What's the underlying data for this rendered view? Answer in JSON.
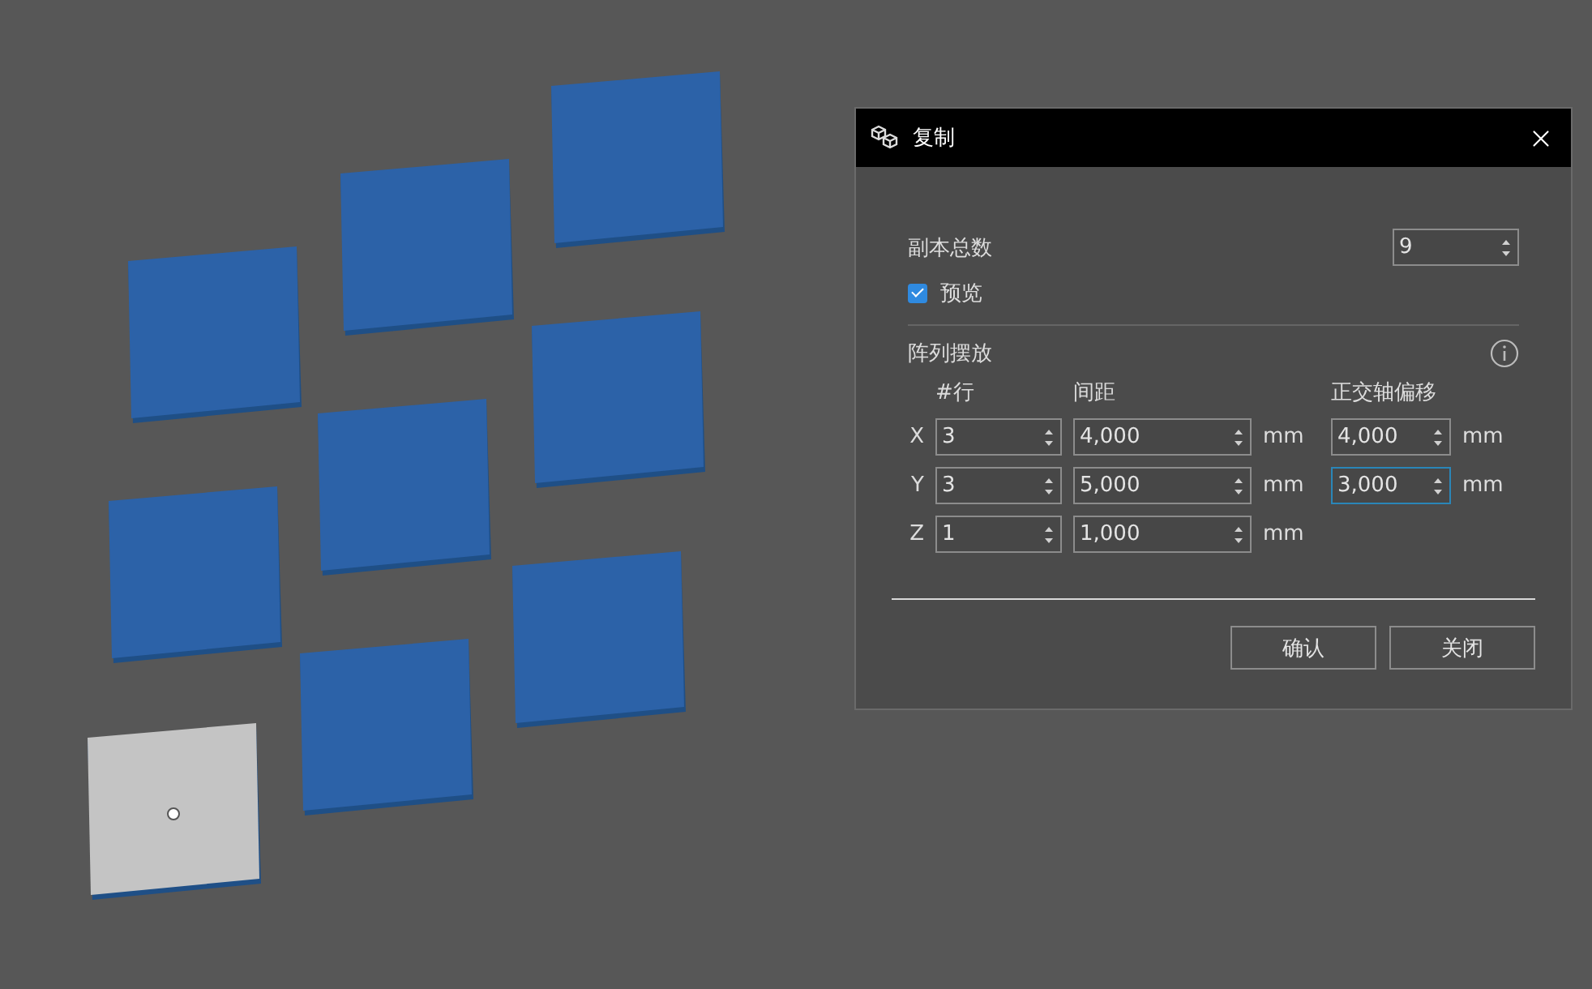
{
  "dialog": {
    "title": "复制",
    "total_copies": {
      "label": "副本总数",
      "value": "9"
    },
    "preview": {
      "label": "预览",
      "checked": true
    },
    "array": {
      "title": "阵列摆放",
      "columns": [
        "#行",
        "间距",
        "正交轴偏移"
      ],
      "rows": [
        {
          "axis": "X",
          "count": "3",
          "spacing": "4,000",
          "spacing_unit": "mm",
          "offset": {
            "value": "4,000",
            "unit": "mm",
            "focused": false
          }
        },
        {
          "axis": "Y",
          "count": "3",
          "spacing": "5,000",
          "spacing_unit": "mm",
          "offset": {
            "value": "3,000",
            "unit": "mm",
            "focused": true
          }
        },
        {
          "axis": "Z",
          "count": "1",
          "spacing": "1,000",
          "spacing_unit": "mm"
        }
      ]
    },
    "buttons": [
      "确认",
      "关闭"
    ]
  }
}
